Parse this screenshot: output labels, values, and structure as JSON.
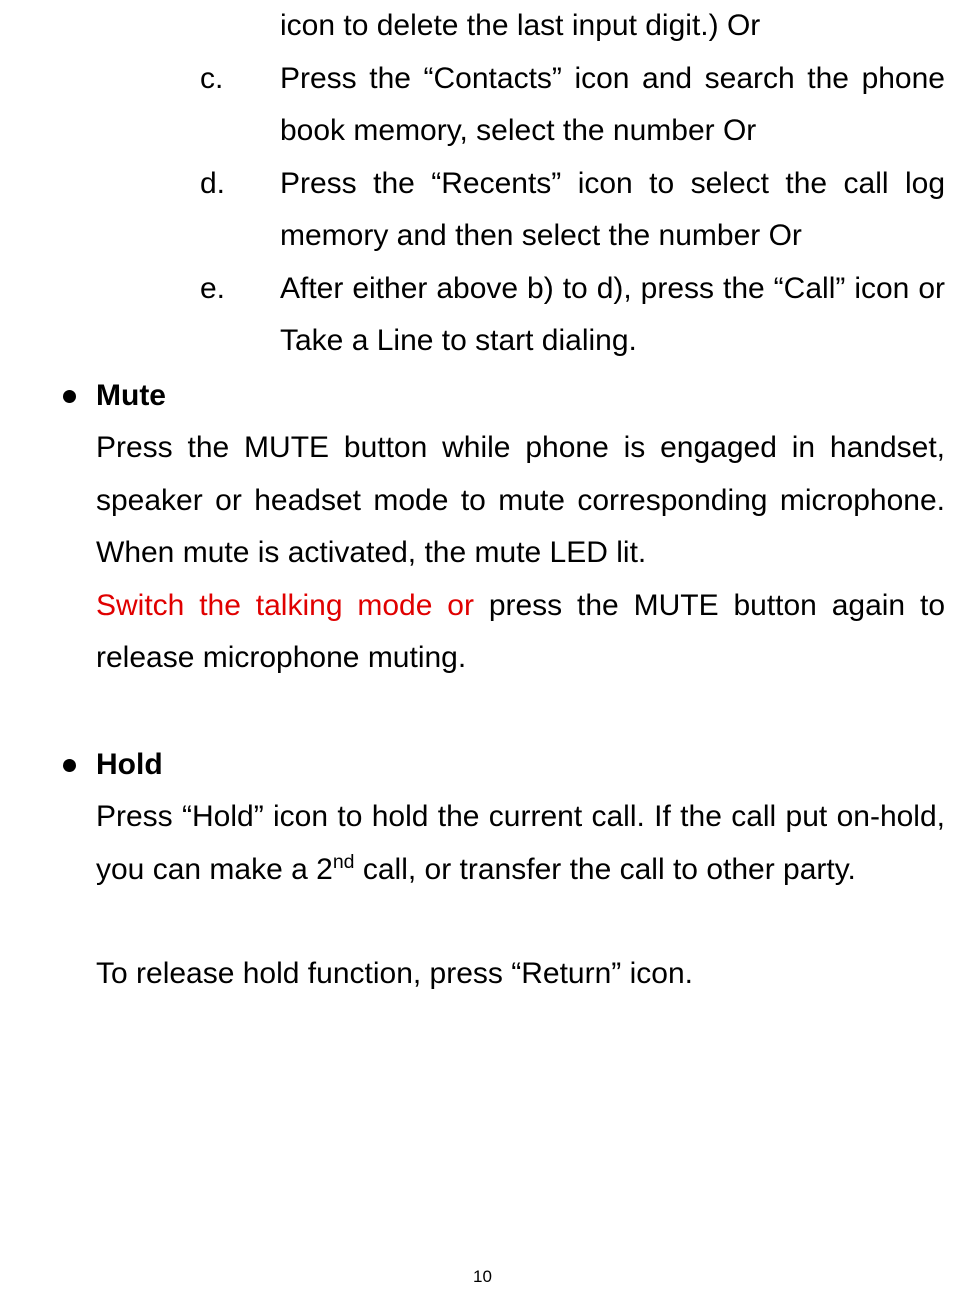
{
  "topFragment": "icon to delete the last input digit.) Or",
  "items": {
    "c": {
      "marker": "c.",
      "text": "Press the “Contacts” icon and search the phone book memory, select the number Or"
    },
    "d": {
      "marker": "d.",
      "text": "Press the “Recents” icon to select the call log memory and then select the number Or"
    },
    "e": {
      "marker": "e.",
      "text": "After either above b) to d), press the “Call” icon or Take a Line to start dialing."
    }
  },
  "mute": {
    "heading": "Mute",
    "para1": "Press the MUTE button while phone is engaged in handset, speaker or headset mode to mute corresponding microphone. When mute is activated, the mute LED lit.",
    "redPart": "Switch the talking mode or ",
    "para2rest": "press the MUTE button again to release microphone muting."
  },
  "hold": {
    "heading": "Hold",
    "para1_a": "Press “Hold” icon to hold the current call. If the call put on-hold, you can make a 2",
    "para1_sup": "nd",
    "para1_b": " call, or transfer the call to other party.",
    "para2": "To release hold function, press “Return” icon."
  },
  "pageNumber": "10"
}
